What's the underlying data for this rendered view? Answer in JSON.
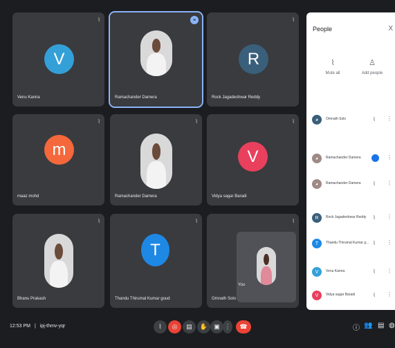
{
  "colors": {
    "venu": "#34a0d8",
    "rock": "#3a5f7b",
    "maaz": "#f4683b",
    "vidya": "#e8405d",
    "thandu": "#1e88e5"
  },
  "tiles": [
    {
      "name": "Venu Kanna",
      "letter": "V"
    },
    {
      "name": "Ramachander Damera"
    },
    {
      "name": "Rock Jagadeshwar Reddy",
      "letter": "R"
    },
    {
      "name": "maaz mohd",
      "letter": "m"
    },
    {
      "name": "Ramachander Damera"
    },
    {
      "name": "Vidya sagar Baradi",
      "letter": "V"
    },
    {
      "name": "Bhanu Prakash"
    },
    {
      "name": "Thandu Thirumal Kumar goud",
      "letter": "T"
    },
    {
      "name": "Omnath Solo",
      "self_label": "You"
    }
  ],
  "meeting": {
    "time": "12:53 PM",
    "divider": "|",
    "code": "ipj-thmv-yqr"
  },
  "panel": {
    "title": "People",
    "close": "X",
    "mute_all": "Mute all",
    "add_people": "Add people",
    "participants": [
      {
        "name": "Omnath Solo"
      },
      {
        "name": "Ramachander Damera"
      },
      {
        "name": "Ramachander Damera"
      },
      {
        "name": "Rock Jagadeshwar Reddy",
        "letter": "R"
      },
      {
        "name": "Thandu Thirumal Kumar g...",
        "letter": "T"
      },
      {
        "name": "Venu Kanna",
        "letter": "V"
      },
      {
        "name": "Vidya sagar Baradi",
        "letter": "V"
      }
    ]
  }
}
